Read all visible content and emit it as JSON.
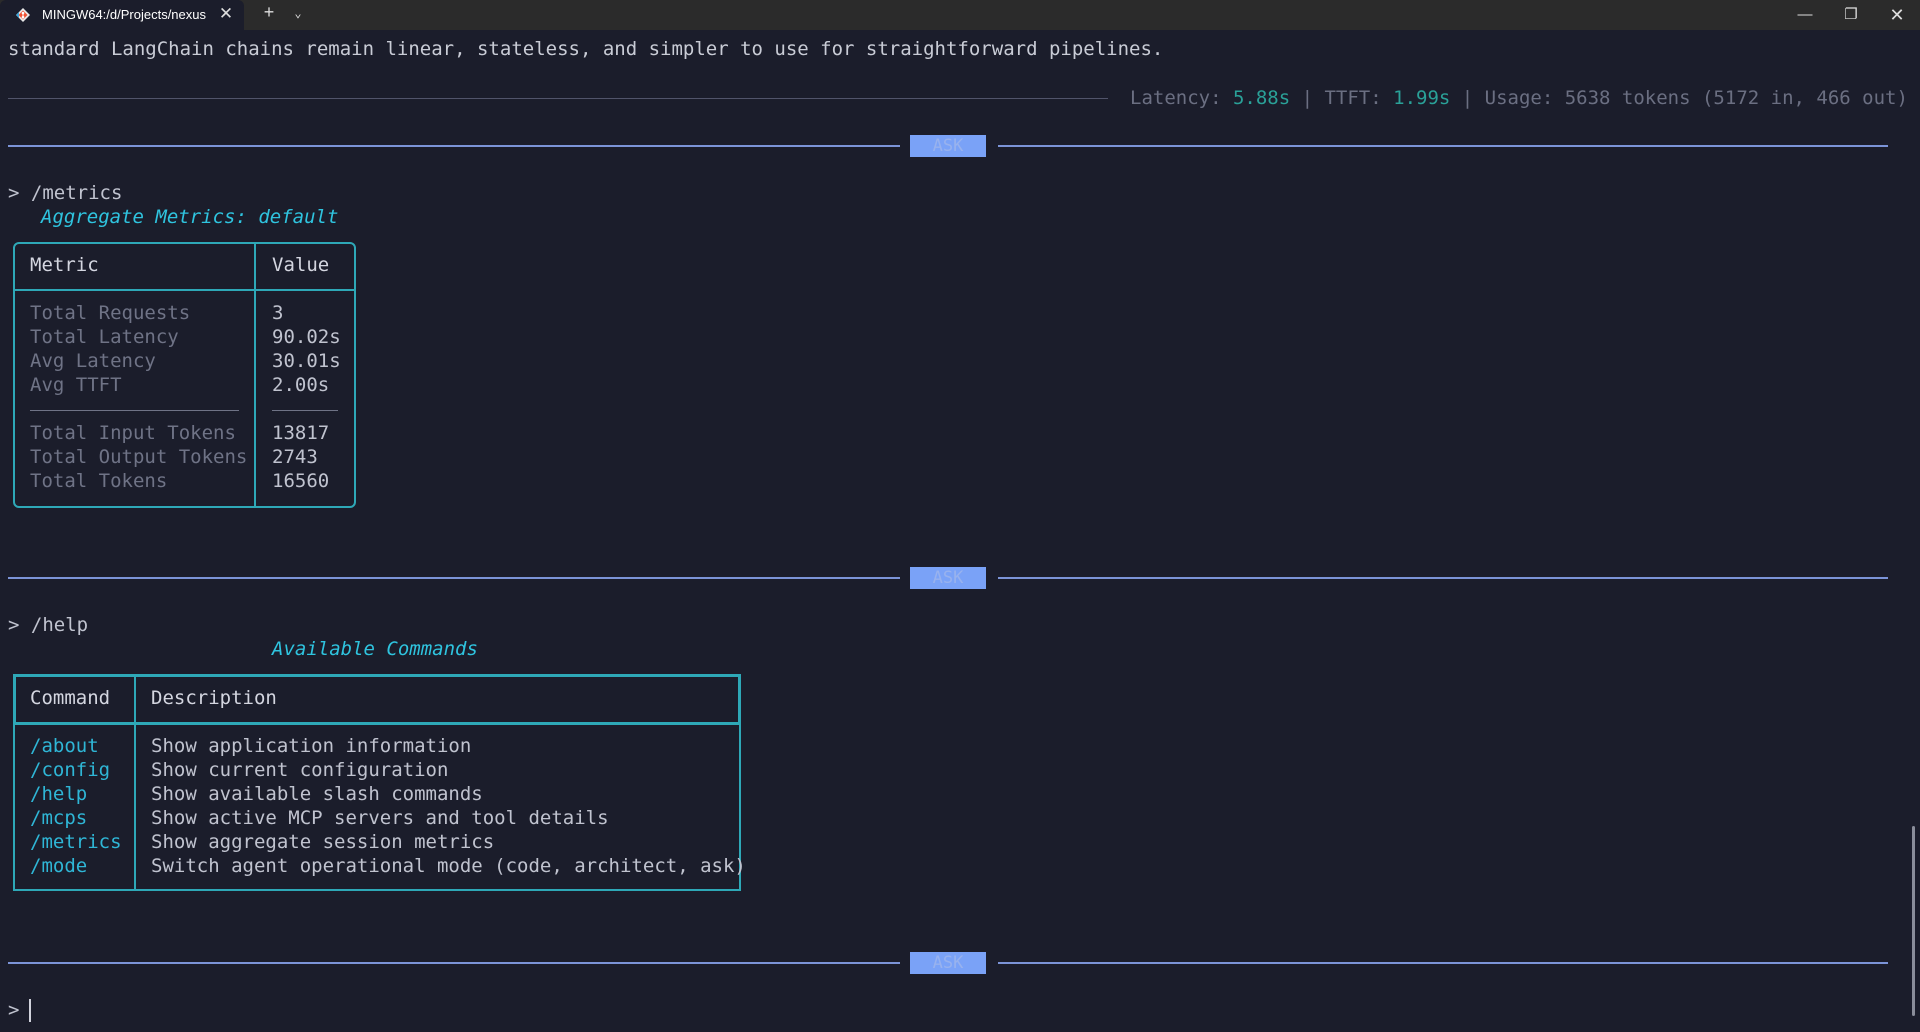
{
  "window": {
    "tab_title": "MINGW64:/d/Projects/nexus",
    "close_glyph": "✕",
    "new_tab_glyph": "+",
    "tab_menu_glyph": "⌄",
    "minimize_glyph": "—",
    "maximize_glyph": "❐",
    "win_close_glyph": "✕"
  },
  "terminal": {
    "top_line": "standard LangChain chains remain linear, stateless, and simpler to use for straightforward pipelines.",
    "status": {
      "latency_label": "Latency: ",
      "latency_value": "5.88s",
      "sep1": " | ",
      "ttft_label": "TTFT: ",
      "ttft_value": "1.99s",
      "sep2": " | ",
      "usage": "Usage: 5638 tokens (5172 in, 466 out)"
    },
    "mode_badge": "ASK",
    "prompt_char": ">",
    "metrics_cmd": "> /metrics",
    "metrics_title": "Aggregate Metrics: default",
    "metrics_table": {
      "headers": [
        "Metric",
        "Value"
      ],
      "rows": [
        [
          "Total Requests",
          "3"
        ],
        [
          "Total Latency",
          "90.02s"
        ],
        [
          "Avg Latency",
          "30.01s"
        ],
        [
          "Avg TTFT",
          "2.00s"
        ],
        [
          "Total Input Tokens",
          "13817"
        ],
        [
          "Total Output Tokens",
          "2743"
        ],
        [
          "Total Tokens",
          "16560"
        ]
      ]
    },
    "help_cmd": "> /help",
    "help_title": "Available Commands",
    "help_table": {
      "headers": [
        "Command",
        "Description"
      ],
      "rows": [
        [
          "/about",
          "Show application information"
        ],
        [
          "/config",
          "Show current configuration"
        ],
        [
          "/help",
          "Show available slash commands"
        ],
        [
          "/mcps",
          "Show active MCP servers and tool details"
        ],
        [
          "/metrics",
          "Show aggregate session metrics"
        ],
        [
          "/mode",
          "Switch agent operational mode (code, architect, ask)"
        ]
      ]
    }
  }
}
